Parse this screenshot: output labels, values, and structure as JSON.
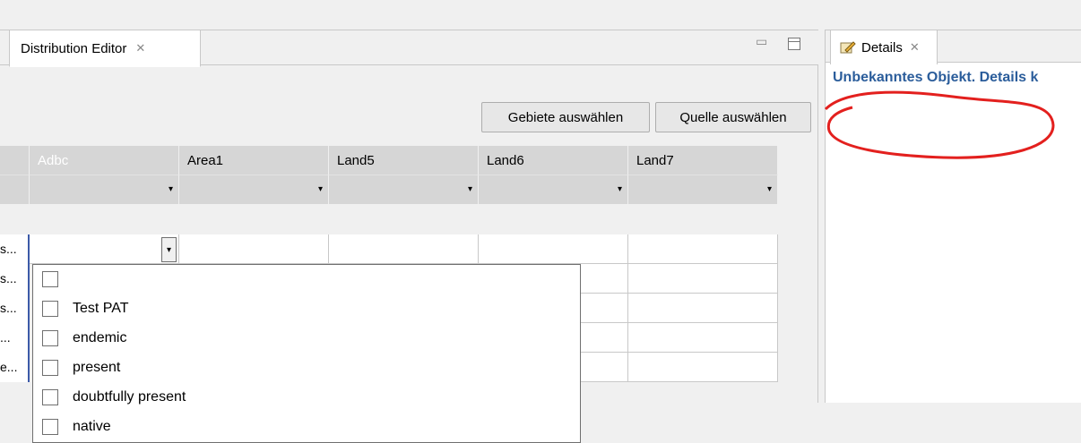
{
  "editor": {
    "tab_title": "Distribution Editor",
    "tab_close": "✕",
    "minimize": "▭",
    "maximize": "□",
    "buttons": {
      "gebiete": "Gebiete auswählen",
      "quelle": "Quelle auswählen"
    },
    "columns": [
      "Adbc",
      "Area1",
      "Land5",
      "Land6",
      "Land7"
    ],
    "row_stubs": [
      "s...",
      "s...",
      "s...",
      "...",
      "e..."
    ],
    "dropdown_items": [
      "",
      "Test PAT",
      "endemic",
      "present",
      "doubtfully present",
      "native"
    ],
    "dropdown_arrow": "▾",
    "filter_arrow": "▾"
  },
  "details": {
    "tab_title": "Details",
    "tab_close": "✕",
    "message": "Unbekanntes Objekt. Details k"
  }
}
